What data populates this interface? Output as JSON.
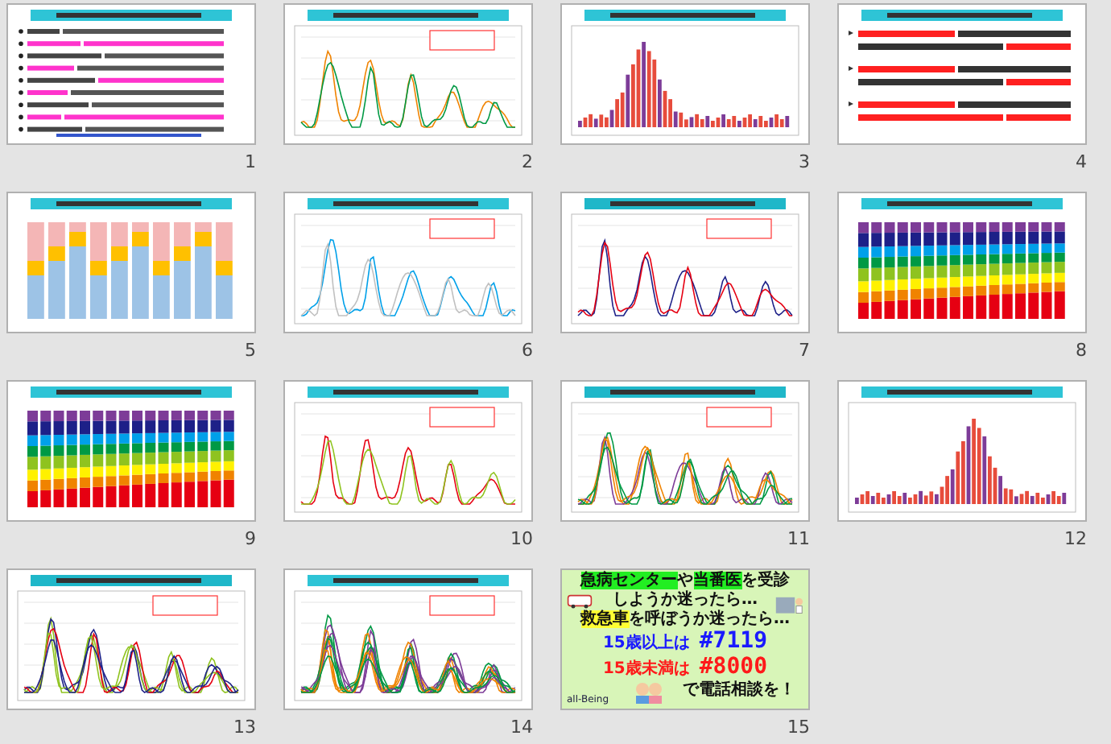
{
  "slides": [
    {
      "number": "1",
      "kind": "bullet-text"
    },
    {
      "number": "2",
      "kind": "line-chart"
    },
    {
      "number": "3",
      "kind": "bar-chart"
    },
    {
      "number": "4",
      "kind": "arrow-text"
    },
    {
      "number": "5",
      "kind": "stacked-bars"
    },
    {
      "number": "6",
      "kind": "line-chart"
    },
    {
      "number": "7",
      "kind": "line-chart"
    },
    {
      "number": "8",
      "kind": "stacked-bars"
    },
    {
      "number": "9",
      "kind": "stacked-bars"
    },
    {
      "number": "10",
      "kind": "line-chart"
    },
    {
      "number": "11",
      "kind": "line-chart"
    },
    {
      "number": "12",
      "kind": "bar-chart"
    },
    {
      "number": "13",
      "kind": "line-chart"
    },
    {
      "number": "14",
      "kind": "line-chart"
    },
    {
      "number": "15",
      "kind": "poster",
      "lines": [
        {
          "kind": "heading",
          "segments": [
            {
              "text": "急病センター",
              "color": "#22ee22"
            },
            {
              "text": "や"
            },
            {
              "text": "当番医",
              "color": "#22ee22"
            },
            {
              "text": "を受診"
            }
          ]
        },
        {
          "kind": "heading",
          "segments": [
            {
              "text": "しようか迷ったら…"
            }
          ]
        },
        {
          "kind": "heading",
          "segments": [
            {
              "text": "救急車",
              "color": "#ffff33"
            },
            {
              "text": "を呼ぼうか迷ったら…"
            }
          ]
        },
        {
          "kind": "number-line",
          "color": "#1a1aff",
          "label": "15歳以上は",
          "number": "#7119"
        },
        {
          "kind": "number-line",
          "color": "#ff1a1a",
          "label": "15歳未満は",
          "number": "#8000"
        },
        {
          "kind": "heading",
          "segments": [
            {
              "text": "で電話相談を！"
            }
          ]
        }
      ],
      "logo": "all-Being"
    }
  ]
}
